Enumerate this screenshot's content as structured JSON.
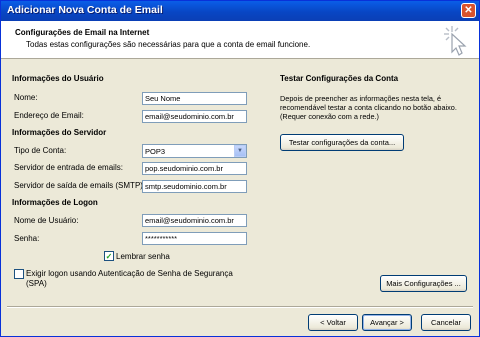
{
  "window": {
    "title": "Adicionar Nova Conta de Email",
    "close_glyph": "✕"
  },
  "header": {
    "title": "Configurações de Email na Internet",
    "subtitle": "Todas estas configurações são necessárias para que a conta de email funcione."
  },
  "user_section": {
    "heading": "Informações do Usuário",
    "name_label": "Nome:",
    "name_value": "Seu Nome",
    "email_label": "Endereço de Email:",
    "email_value": "email@seudominio.com.br"
  },
  "server_section": {
    "heading": "Informações do Servidor",
    "account_type_label": "Tipo de Conta:",
    "account_type_value": "POP3",
    "incoming_label": "Servidor de entrada de emails:",
    "incoming_value": "pop.seudominio.com.br",
    "outgoing_label": "Servidor de saída de emails (SMTP):",
    "outgoing_value": "smtp.seudominio.com.br"
  },
  "logon_section": {
    "heading": "Informações de Logon",
    "username_label": "Nome de Usuário:",
    "username_value": "email@seudominio.com.br",
    "password_label": "Senha:",
    "password_value": "***********",
    "remember_label": "Lembrar senha",
    "remember_checked": true,
    "spa_label_line1": "Exigir logon usando Autenticação de Senha de Segurança",
    "spa_label_line2": "(SPA)",
    "spa_checked": false
  },
  "test_section": {
    "heading": "Testar Configurações da Conta",
    "description": "Depois de preencher as informações nesta tela, é recomendável testar a conta clicando no botão abaixo. (Requer conexão com a rede.)",
    "test_button": "Testar configurações da conta..."
  },
  "buttons": {
    "more_settings": "Mais Configurações ...",
    "back": "< Voltar",
    "next": "Avançar >",
    "cancel": "Cancelar"
  },
  "icons": {
    "header": "cursor-sparkle-icon",
    "dropdown": "chevron-down-icon",
    "check": "checkmark-icon"
  }
}
